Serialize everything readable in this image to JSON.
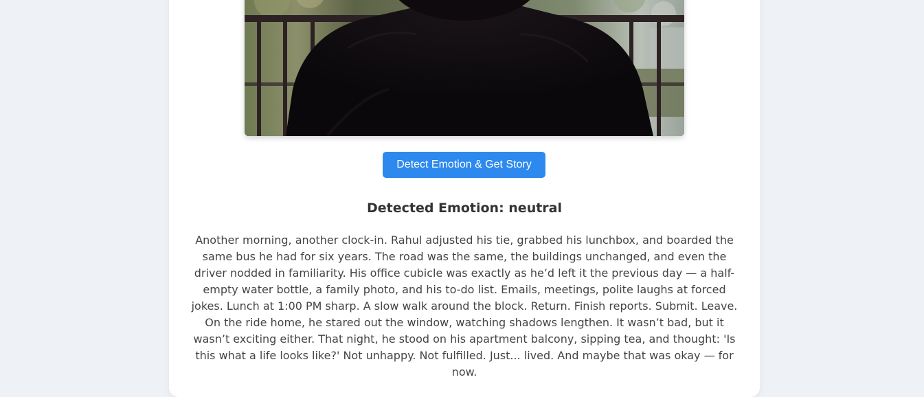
{
  "action": {
    "detect_label": "Detect Emotion & Get Story"
  },
  "result": {
    "emotion_heading": "Detected Emotion: neutral",
    "story": "Another morning, another clock-in. Rahul adjusted his tie, grabbed his lunchbox, and boarded the same bus he had for six years. The road was the same, the buildings unchanged, and even the driver nodded in familiarity. His office cubicle was exactly as he’d left it the previous day — a half-empty water bottle, a family photo, and his to-do list. Emails, meetings, polite laughs at forced jokes. Lunch at 1:00 PM sharp. A slow walk around the block. Return. Finish reports. Submit. Leave. On the ride home, he stared out the window, watching shadows lengthen. It wasn’t bad, but it wasn’t exciting either. That night, he stood on his apartment balcony, sipping tea, and thought: 'Is this what a life looks like?' Not unhappy. Not fulfilled. Just... lived. And maybe that was okay — for now."
  },
  "colors": {
    "page_background": "#eef2f7",
    "card_background": "#ffffff",
    "button_background": "#2d89ee",
    "button_text": "#ffffff",
    "heading_text": "#333333",
    "body_text": "#444444"
  }
}
